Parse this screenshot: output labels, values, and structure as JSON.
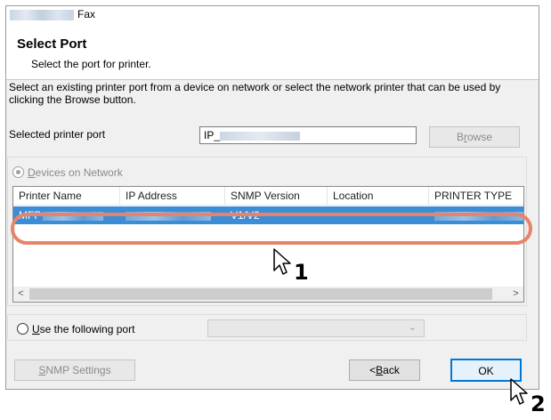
{
  "window": {
    "title": "Fax",
    "heading": "Select Port",
    "subheading": "Select the port for printer."
  },
  "instruction": "Select an existing printer port from a device on network or select the network printer that can be used by clicking the Browse button.",
  "selected_port": {
    "label": "Selected printer port",
    "value_prefix": "IP_",
    "browse_label_pre": "B",
    "browse_label_ul": "r",
    "browse_label_post": "owse"
  },
  "devices": {
    "radio_pre": "",
    "radio_ul": "D",
    "radio_post": "evices on Network",
    "columns": [
      "Printer Name",
      "IP Address",
      "SNMP Version",
      "Location",
      "PRINTER TYPE"
    ],
    "rows": [
      {
        "printer_name": "MFP",
        "ip_address": "",
        "snmp_version": "V1/V2",
        "location": "",
        "printer_type": ""
      }
    ],
    "scroll_left": "<",
    "scroll_right": ">"
  },
  "use_port": {
    "radio_ul": "U",
    "radio_post": "se the following port",
    "combo_value": ""
  },
  "buttons": {
    "snmp_ul": "S",
    "snmp_post": "NMP Settings",
    "back_pre": "<",
    "back_ul": "B",
    "back_post": "ack",
    "ok": "OK"
  },
  "callouts": {
    "step1": "1",
    "step2": "2",
    "highlight_color": "#e8836a",
    "selection_color": "#3b8dd6"
  }
}
